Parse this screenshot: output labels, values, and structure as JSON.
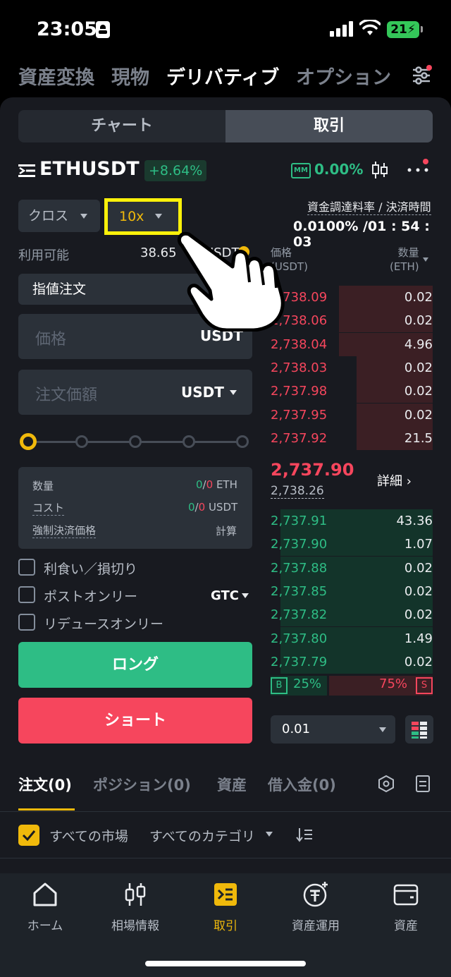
{
  "status_bar": {
    "time": "23:05",
    "battery": "21"
  },
  "top_nav": {
    "tabs": [
      "資産変換",
      "現物",
      "デリバティブ",
      "オプション"
    ],
    "active": "デリバティブ"
  },
  "segment": {
    "chart": "チャート",
    "trade": "取引",
    "active": "取引"
  },
  "symbol": {
    "name": "ETHUSDT",
    "change": "+8.64%",
    "mm_badge": "MM",
    "mm_value": "0.00%"
  },
  "margin": {
    "mode": "クロス",
    "leverage": "10x"
  },
  "funding": {
    "label": "資金調達料率 / 決済時間",
    "value": "0.0100% /01 : 54 : 03"
  },
  "available": {
    "label": "利用可能",
    "value": "38.65",
    "unit": "USDT"
  },
  "order_type": "指値注文",
  "price_input": {
    "placeholder": "価格",
    "unit": "USDT"
  },
  "amount_input": {
    "placeholder": "注文価額",
    "unit": "USDT"
  },
  "slider": {
    "percent": 0
  },
  "info": {
    "qty_label": "数量",
    "qty_buy": "0",
    "qty_sep": "/",
    "qty_sell": "0",
    "qty_unit": "ETH",
    "cost_label": "コスト",
    "cost_buy": "0",
    "cost_sep": "/",
    "cost_sell": "0",
    "cost_unit": "USDT",
    "liq_label": "強制決済価格",
    "liq_value": "計算"
  },
  "options": {
    "tpsl": "利食い／損切り",
    "post_only": "ポストオンリー",
    "reduce_only": "リデュースオンリー",
    "tif": "GTC"
  },
  "buttons": {
    "long": "ロング",
    "short": "ショート"
  },
  "order_book": {
    "price_header_1": "価格",
    "price_header_2": "(USDT)",
    "qty_header_1": "数量",
    "qty_header_2": "(ETH)",
    "asks": [
      {
        "price": "2,738.09",
        "qty": "0.02",
        "depth": 0.58
      },
      {
        "price": "2,738.06",
        "qty": "0.02",
        "depth": 0.58
      },
      {
        "price": "2,738.04",
        "qty": "4.96",
        "depth": 0.58
      },
      {
        "price": "2,738.03",
        "qty": "0.02",
        "depth": 0.47
      },
      {
        "price": "2,737.98",
        "qty": "0.02",
        "depth": 0.47
      },
      {
        "price": "2,737.95",
        "qty": "0.02",
        "depth": 0.47
      },
      {
        "price": "2,737.92",
        "qty": "21.5",
        "depth": 0.47
      }
    ],
    "last_price": "2,737.90",
    "mark_price": "2,738.26",
    "detail": "詳細 ›",
    "bids": [
      {
        "price": "2,737.91",
        "qty": "43.36",
        "depth": 0.94
      },
      {
        "price": "2,737.90",
        "qty": "1.07",
        "depth": 0.94
      },
      {
        "price": "2,737.88",
        "qty": "0.02",
        "depth": 0.94
      },
      {
        "price": "2,737.85",
        "qty": "0.02",
        "depth": 0.94
      },
      {
        "price": "2,737.82",
        "qty": "0.02",
        "depth": 0.94
      },
      {
        "price": "2,737.80",
        "qty": "1.49",
        "depth": 0.94
      },
      {
        "price": "2,737.79",
        "qty": "0.02",
        "depth": 0.94
      }
    ],
    "buy_ratio_badge": "B",
    "buy_ratio": "25%",
    "sell_ratio": "75%",
    "sell_ratio_badge": "S",
    "depth_step": "0.01"
  },
  "bottom_tabs": {
    "orders": "注文(0)",
    "positions": "ポジション(0)",
    "assets": "資産",
    "borrow": "借入金(0)"
  },
  "filters": {
    "all_markets": "すべての市場",
    "all_categories": "すべてのカテゴリ"
  },
  "bottom_nav": [
    {
      "label": "ホーム",
      "icon": "home-icon"
    },
    {
      "label": "相場情報",
      "icon": "market-icon"
    },
    {
      "label": "取引",
      "icon": "trade-icon"
    },
    {
      "label": "資産運用",
      "icon": "earn-icon"
    },
    {
      "label": "資産",
      "icon": "wallet-icon"
    }
  ],
  "colors": {
    "up": "#2ebd85",
    "down": "#f6465d",
    "accent": "#f0b90b",
    "highlight": "#fcf10a"
  }
}
